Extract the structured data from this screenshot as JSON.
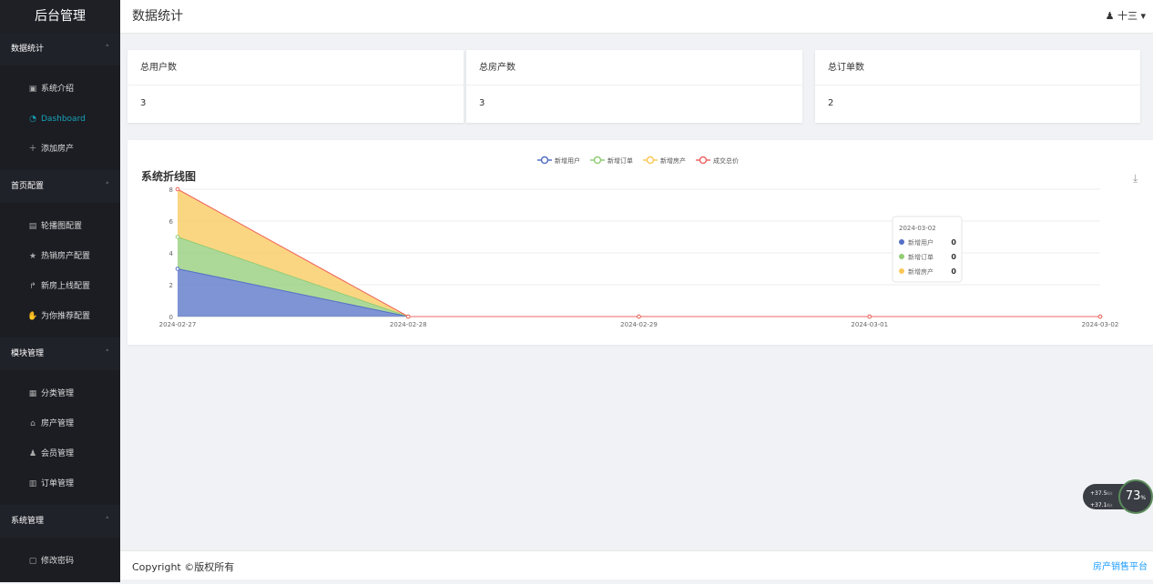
{
  "sidebar": {
    "logo": "后台管理",
    "groups": [
      {
        "title": "数据统计",
        "items": [
          {
            "label": "系统介绍",
            "icon": "monitor-icon"
          },
          {
            "label": "Dashboard",
            "icon": "dashboard-icon",
            "active": true
          },
          {
            "label": "添加房产",
            "icon": "plus-icon"
          }
        ]
      },
      {
        "title": "首页配置",
        "items": [
          {
            "label": "轮播图配置",
            "icon": "image-icon"
          },
          {
            "label": "热销房产配置",
            "icon": "star-icon"
          },
          {
            "label": "新房上线配置",
            "icon": "share-icon"
          },
          {
            "label": "为你推荐配置",
            "icon": "thumb-icon"
          }
        ]
      },
      {
        "title": "模块管理",
        "items": [
          {
            "label": "分类管理",
            "icon": "grid-icon"
          },
          {
            "label": "房产管理",
            "icon": "home-icon"
          },
          {
            "label": "会员管理",
            "icon": "user-icon"
          },
          {
            "label": "订单管理",
            "icon": "order-icon"
          }
        ]
      },
      {
        "title": "系统管理",
        "items": [
          {
            "label": "修改密码",
            "icon": "lock-icon"
          }
        ]
      }
    ]
  },
  "header": {
    "title": "数据统计",
    "user": "十三"
  },
  "cards": [
    {
      "title": "总用户数",
      "value": "3"
    },
    {
      "title": "总房产数",
      "value": "3"
    },
    {
      "title": "总订单数",
      "value": "2"
    }
  ],
  "chart_data": {
    "type": "area",
    "title": "系统折线图",
    "x": [
      "2024-02-27",
      "2024-02-28",
      "2024-02-29",
      "2024-03-01",
      "2024-03-02"
    ],
    "series": [
      {
        "name": "新增用户",
        "values": [
          3,
          0,
          0,
          0,
          0
        ],
        "color": "#5470c6"
      },
      {
        "name": "新增订单",
        "values": [
          2,
          0,
          0,
          0,
          0
        ],
        "color": "#91cc75"
      },
      {
        "name": "新增房产",
        "values": [
          3,
          0,
          0,
          0,
          0
        ],
        "color": "#fac858"
      },
      {
        "name": "成交总价",
        "values": [
          0,
          0,
          0,
          0,
          0
        ],
        "color": "#ee6666"
      }
    ],
    "stacked": true,
    "ylim": [
      0,
      8
    ],
    "yticks": [
      0,
      2,
      4,
      6,
      8
    ],
    "legend_position": "top-center",
    "grid": true,
    "tooltip": {
      "date": "2024-03-02",
      "rows": [
        {
          "name": "新增用户",
          "value": "0",
          "color": "#5470c6"
        },
        {
          "name": "新增订单",
          "value": "0",
          "color": "#91cc75"
        },
        {
          "name": "新增房产",
          "value": "0",
          "color": "#fac858"
        }
      ]
    }
  },
  "footer": {
    "copyright": "Copyright ©版权所有",
    "brand": "房产销售平台"
  },
  "net_widget": {
    "up": "+37.5",
    "up_unit": "K/s",
    "down": "+37.1",
    "down_unit": "K/s",
    "percent": "73",
    "percent_unit": "%"
  }
}
